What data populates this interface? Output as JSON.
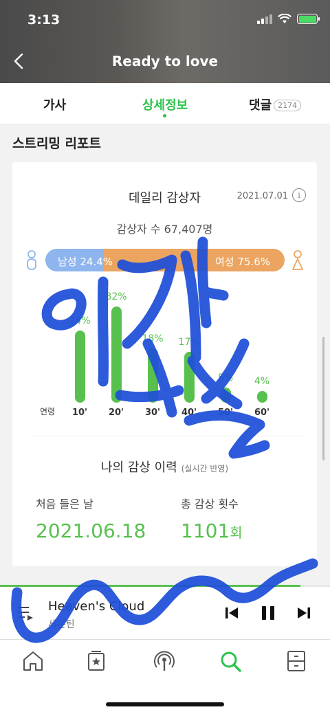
{
  "status_bar": {
    "time": "3:13"
  },
  "header": {
    "title": "Ready to love"
  },
  "tabs": [
    {
      "label": "가사"
    },
    {
      "label": "상세정보"
    },
    {
      "label": "댓글",
      "badge": "2174"
    }
  ],
  "section": {
    "title": "스트리밍 리포트"
  },
  "daily": {
    "title": "데일리 감상자",
    "date": "2021.07.01",
    "info_icon": "i",
    "listener_count": "감상자 수 67,407명",
    "male": {
      "label": "남성 24.4%",
      "value": 24.4
    },
    "female": {
      "label": "여성 75.6%",
      "value": 75.6
    }
  },
  "chart_data": {
    "type": "bar",
    "xlabel": "연령",
    "categories": [
      "10'",
      "20'",
      "30'",
      "40'",
      "50'",
      "60'"
    ],
    "values": [
      24,
      32,
      18,
      17,
      5,
      4
    ],
    "value_labels": [
      "24%",
      "32%",
      "18%",
      "17%",
      "5%",
      "4%"
    ],
    "bar_color": "#58c14e"
  },
  "history": {
    "title": "나의 감상 이력",
    "subtitle": "(실시간 반영)",
    "first_label": "처음 들은 날",
    "first_value": "2021.06.18",
    "count_label": "총 감상 횟수",
    "count_value": "1101",
    "count_unit": "회"
  },
  "player": {
    "title": "Heaven's Cloud",
    "artist": "세븐틴",
    "progress": 0.91
  },
  "colors": {
    "accent": "#2cc34a",
    "male": "#8fb5ee",
    "female": "#eba560",
    "scribble": "#1e4fd8"
  },
  "bottom_nav": [
    "home-icon",
    "playlist-star-icon",
    "podcast-icon",
    "search-icon",
    "drawer-icon"
  ]
}
